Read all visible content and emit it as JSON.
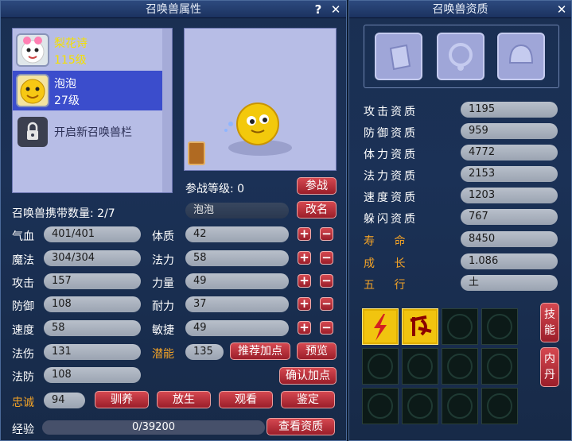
{
  "left_panel": {
    "title": "召唤兽属性",
    "help_label": "?",
    "close_label": "✕",
    "pets": [
      {
        "name": "梨花诗",
        "level": "115级"
      },
      {
        "name": "泡泡",
        "level": "27级"
      }
    ],
    "unlock_label": "开启新召唤兽栏",
    "battle_level_label": "参战等级: 0",
    "battle_button": "参战",
    "carry_count": "召唤兽携带数量: 2/7",
    "pet_name_value": "泡泡",
    "rename_button": "改名",
    "stats_left": [
      {
        "label": "气血",
        "value": "401/401"
      },
      {
        "label": "魔法",
        "value": "304/304"
      },
      {
        "label": "攻击",
        "value": "157"
      },
      {
        "label": "防御",
        "value": "108"
      },
      {
        "label": "速度",
        "value": "58"
      },
      {
        "label": "法伤",
        "value": "131"
      },
      {
        "label": "法防",
        "value": "108"
      }
    ],
    "stats_right": [
      {
        "label": "体质",
        "value": "42"
      },
      {
        "label": "法力",
        "value": "58"
      },
      {
        "label": "力量",
        "value": "49"
      },
      {
        "label": "耐力",
        "value": "37"
      },
      {
        "label": "敏捷",
        "value": "49"
      }
    ],
    "plus_symbol": "+",
    "minus_symbol": "−",
    "potential_label": "潜能",
    "potential_value": "135",
    "recommend_button": "推荐加点",
    "preview_button": "预览",
    "confirm_button": "确认加点",
    "loyalty_label": "忠诚",
    "loyalty_value": "94",
    "action_buttons": [
      "驯养",
      "放生",
      "观看",
      "鉴定"
    ],
    "exp_label": "经验",
    "exp_value": "0/39200",
    "view_aptitude_button": "查看资质"
  },
  "right_panel": {
    "title": "召唤兽资质",
    "close_label": "✕",
    "equip_slots": [
      "armor-slot-icon",
      "necklace-slot-icon",
      "helmet-slot-icon"
    ],
    "aptitudes": [
      {
        "label": "攻击资质",
        "value": "1195"
      },
      {
        "label": "防御资质",
        "value": "959"
      },
      {
        "label": "体力资质",
        "value": "4772"
      },
      {
        "label": "法力资质",
        "value": "2153"
      },
      {
        "label": "速度资质",
        "value": "1203"
      },
      {
        "label": "躲闪资质",
        "value": "767"
      }
    ],
    "lifespan_label": "寿 命",
    "lifespan_value": "8450",
    "growth_label": "成 长",
    "growth_value": "1.086",
    "element_label": "五 行",
    "element_value": "土",
    "skills_button": "技能",
    "neidan_button": "内丹",
    "skill_icons": [
      "lightning-skill-icon",
      "spell-rune-skill-icon"
    ]
  },
  "colors": {
    "accent_orange": "#f2a227",
    "button_red": "#b8303a",
    "panel_blue": "#1b3156"
  }
}
